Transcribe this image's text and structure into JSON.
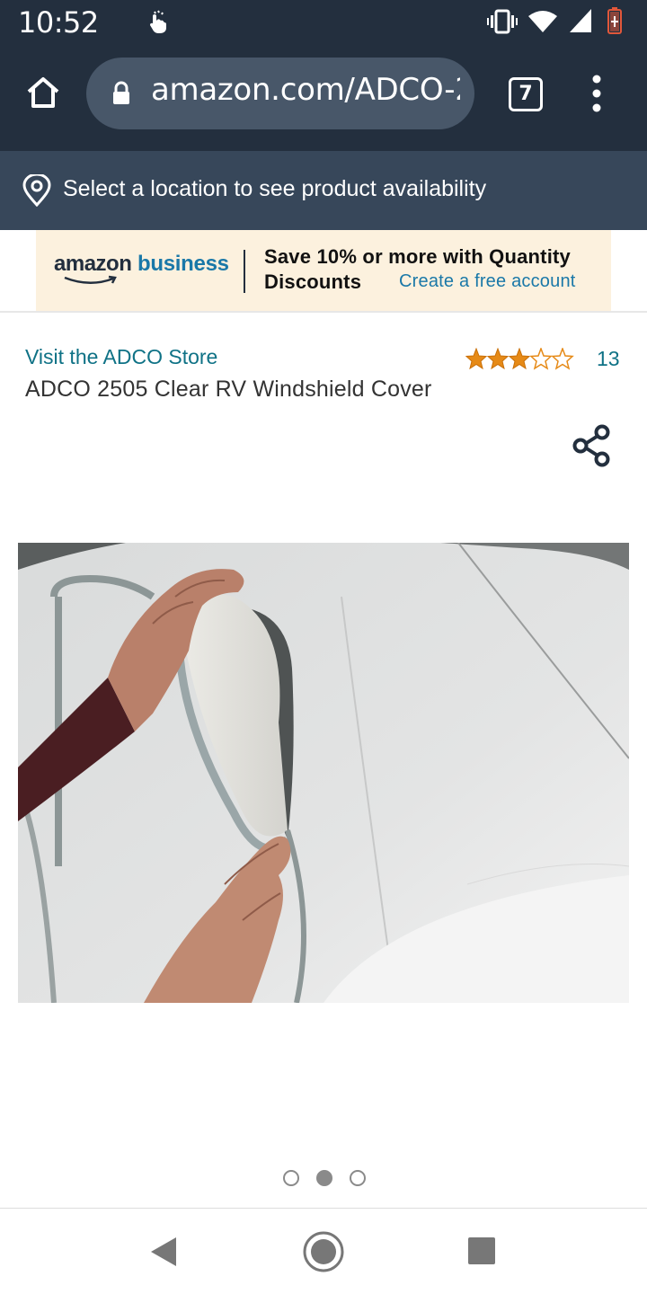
{
  "status_bar": {
    "time": "10:52",
    "icons": [
      "touch-gesture-icon",
      "vibrate-icon",
      "wifi-icon",
      "signal-icon",
      "battery-low-icon"
    ],
    "battery_color": "#e2573a"
  },
  "browser": {
    "url": "amazon.com/ADCO-2",
    "tab_count": "7",
    "icons": [
      "home-icon",
      "lock-icon",
      "more-vert-icon"
    ]
  },
  "location": {
    "text": "Select a location to see product availability",
    "icon": "location-pin-icon"
  },
  "business_banner": {
    "logo_amazon": "amazon",
    "logo_business": "business",
    "promo_line1": "Save 10% or more with Quantity",
    "promo_line2": "Discounts",
    "cta": "Create a free account"
  },
  "product": {
    "store_link": "Visit the ADCO Store",
    "title": "ADCO 2505 Clear RV Windshield Cover",
    "rating_stars": 3,
    "rating_max": 5,
    "review_count": "13",
    "share_icon": "share-icon",
    "image_index": 1,
    "image_count": 3
  },
  "nav_bar": {
    "icons": [
      "back-icon",
      "home-circle-icon",
      "recents-icon"
    ]
  },
  "colors": {
    "chrome_dark": "#232f3e",
    "location_bar": "#37475a",
    "banner_bg": "#fcf1de",
    "link_teal": "#0f7286",
    "business_blue": "#1a78a8",
    "star_orange": "#e68a17"
  }
}
